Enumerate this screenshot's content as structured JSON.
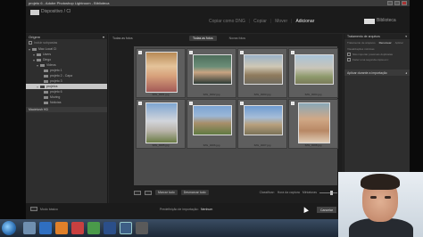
{
  "window": {
    "title": "projeto 6 - Adobe Photoshop Lightroom - Biblioteca"
  },
  "top_bar": {
    "source_label": "Dispositivo / Cl",
    "source_sub": "",
    "modes": [
      "Copiar como DNG",
      "Copiar",
      "Mover",
      "Adicionar"
    ],
    "active_mode": "Adicionar",
    "dest_label": "Biblioteca",
    "dest_sub": ""
  },
  "left_panel": {
    "header": "Origem",
    "sub_left": "Incluir subpastas",
    "sub_right": "",
    "tree": [
      {
        "label": "Mac Local Cl",
        "level": 0,
        "selected": false
      },
      {
        "label": "Users",
        "level": 0,
        "selected": false
      },
      {
        "label": "Diego",
        "level": 1,
        "selected": false
      },
      {
        "label": "Videos",
        "level": 1,
        "selected": false
      },
      {
        "label": "projeto 1",
        "level": 2,
        "selected": false
      },
      {
        "label": "projeto 2 - Capa",
        "level": 2,
        "selected": false
      },
      {
        "label": "projeto 3",
        "level": 2,
        "selected": false
      },
      {
        "label": "projetos",
        "level": 1,
        "selected": true
      },
      {
        "label": "projeto 6",
        "level": 2,
        "selected": false
      },
      {
        "label": "Moving",
        "level": 2,
        "selected": false
      },
      {
        "label": "Noticias",
        "level": 2,
        "selected": false
      }
    ],
    "drive_header": "Macintosh HD"
  },
  "center": {
    "top_label": "Todas as fotos",
    "view_tabs": [
      "Todas as fotos",
      "Novas fotos"
    ],
    "active_view": "Todas as fotos",
    "photos": [
      {
        "caption": "IMG_0001.jpg",
        "style": "t-girl",
        "portrait": true
      },
      {
        "caption": "IMG_0002.jpg",
        "style": "t-man",
        "portrait": false
      },
      {
        "caption": "IMG_0003.jpg",
        "style": "t-street",
        "portrait": false
      },
      {
        "caption": "IMG_0004.jpg",
        "style": "t-statue",
        "portrait": false
      },
      {
        "caption": "IMG_0005.jpg",
        "style": "t-church",
        "portrait": true
      },
      {
        "caption": "IMG_0006.jpg",
        "style": "t-town",
        "portrait": false
      },
      {
        "caption": "IMG_0007.jpg",
        "style": "t-city",
        "portrait": false
      },
      {
        "caption": "IMG_0008.jpg",
        "style": "t-woman",
        "portrait": true
      }
    ],
    "check_all": "Marcar tudo",
    "uncheck_all": "Desmarcar tudo",
    "sort_label": "Classificar:",
    "sort_value": "Hora da captura",
    "thumbnails_label": "Miniaturas"
  },
  "right_panel": {
    "header": "Tratamento de arquivos",
    "tabs": [
      "Tratamento de arquivos",
      "Renomear",
      "Aplicar"
    ],
    "active_tab": "Renomear",
    "rows": [
      "Visualizações mínimas",
      "Não importar possíveis duplicatas",
      "Fazer uma segunda cópia em:"
    ],
    "section": "Aplicar durante a importação"
  },
  "bottom_bar": {
    "import_mode": "Modo básico",
    "preset_label": "Predefinição de importação:",
    "preset_value": "Nenhum",
    "cancel": "Cancelar",
    "import": "Importar"
  }
}
